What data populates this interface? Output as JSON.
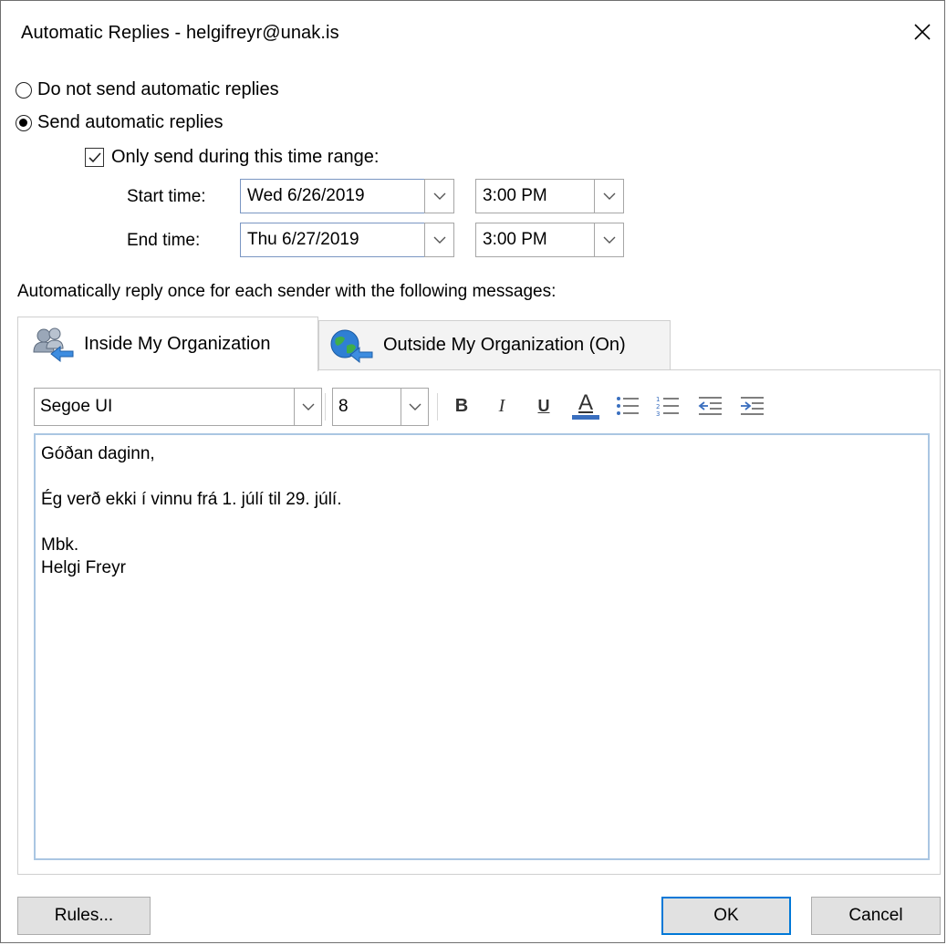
{
  "window": {
    "title": "Automatic Replies - helgifreyr@unak.is",
    "close_label": "✕"
  },
  "options": {
    "no_reply_label": "Do not send automatic replies",
    "send_reply_label": "Send automatic replies",
    "selected": "send",
    "time_range_label": "Only send during this time range:",
    "time_range_checked": true
  },
  "schedule": {
    "start_label": "Start time:",
    "start_date": "Wed 6/26/2019",
    "start_time": "3:00 PM",
    "end_label": "End time:",
    "end_date": "Thu 6/27/2019",
    "end_time": "3:00 PM"
  },
  "instruction": "Automatically reply once for each sender with the following messages:",
  "tabs": [
    {
      "label": "Inside My Organization",
      "icon": "people-arrow-icon",
      "active": true
    },
    {
      "label": "Outside My Organization (On)",
      "icon": "globe-arrow-icon",
      "active": false
    }
  ],
  "toolbar": {
    "font": "Segoe UI",
    "size": "8",
    "bold": "B",
    "italic": "I",
    "underline": "U",
    "font_color_glyph": "A",
    "font_color": "#3a6fbf"
  },
  "message": {
    "line1": "Góðan daginn,",
    "line2": "",
    "line3": "Ég verð ekki í vinnu frá 1. júlí til 29. júlí.",
    "line4": "",
    "line5": "Mbk.",
    "line6": "Helgi Freyr"
  },
  "buttons": {
    "rules": "Rules...",
    "ok": "OK",
    "cancel": "Cancel"
  },
  "colors": {
    "accent": "#0078d7",
    "editor_border": "#aac6e2"
  }
}
